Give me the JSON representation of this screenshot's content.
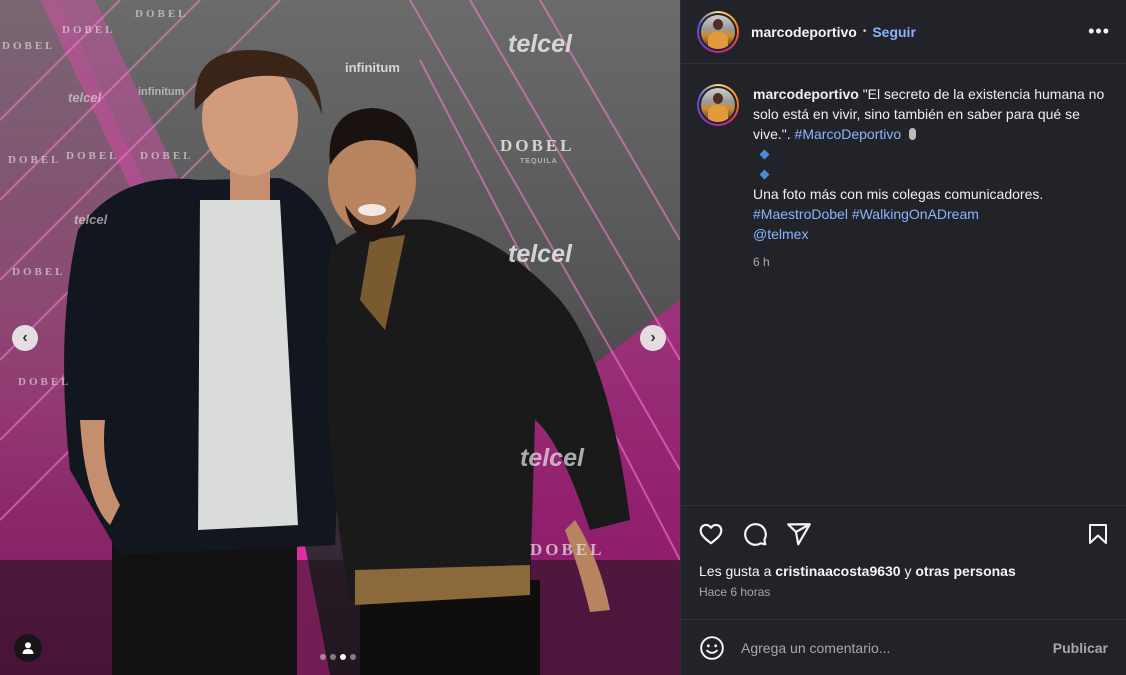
{
  "post": {
    "author": "marcodeportivo",
    "separator": "•",
    "follow_label": "Seguir",
    "more_label": "•••",
    "caption_quote": "\"El secreto de la existencia humana no solo está en vivir, sino también en saber para qué se vive.\".",
    "caption_hashtag_1": "#MarcoDeportivo",
    "caption_line_2": "Una foto más con mis colegas comunicadores.",
    "caption_hashtag_2": "#MaestroDobel",
    "caption_hashtag_3": "#WalkingOnADream",
    "caption_mention": "@telmex",
    "caption_time": "6 h",
    "likes_prefix": "Les gusta a",
    "likes_user": "cristinaacosta9630",
    "likes_middle": "y",
    "likes_suffix": "otras personas",
    "posted_ago": "Hace 6 horas"
  },
  "comment": {
    "placeholder": "Agrega un comentario...",
    "publish_label": "Publicar"
  },
  "carousel": {
    "prev_glyph": "‹",
    "next_glyph": "›",
    "slide_count": 4,
    "active_slide": 3
  },
  "backdrop": {
    "telcel": "telcel",
    "dobel": "DOBEL",
    "tequila": "TEQUILA",
    "infinitum": "infinitum"
  },
  "colors": {
    "panel_bg": "#212328",
    "link": "#8ab4ff",
    "accent_pink": "#ff2fb0"
  },
  "icons": [
    "heart-icon",
    "comment-icon",
    "share-icon",
    "bookmark-icon",
    "emoji-icon",
    "more-icon",
    "user-tag-icon"
  ]
}
